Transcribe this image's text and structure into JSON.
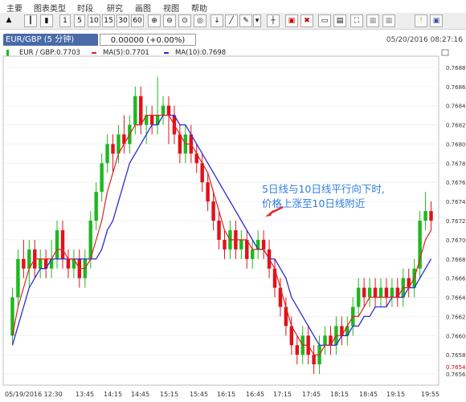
{
  "menu": [
    "主要",
    "图表类型",
    "时段",
    "研究",
    "画图",
    "视图",
    "帮助"
  ],
  "toolbar": {
    "periods": [
      "1",
      "5",
      "10",
      "15",
      "30",
      "60"
    ],
    "icons": [
      "pointer-icon",
      "bar-chart-icon",
      "candlestick-icon",
      "zoom-in-icon",
      "zoom-out-icon",
      "zoom-reset-icon",
      "zoom-fit-icon",
      "download-icon",
      "line-draw-icon",
      "pen-icon",
      "dropdown-icon",
      "crosshair-icon",
      "delete-box-icon",
      "delete-icon",
      "panel-icon",
      "panel2-icon",
      "fullscreen-icon",
      "print-icon",
      "save-icon",
      "flag-icon",
      "disk-icon"
    ]
  },
  "tab": {
    "symbol": "EUR/GBP (5 分钟)",
    "price": "0.00000 (+0.00%)",
    "datetime": "05/20/2016 08:27:16"
  },
  "legend": {
    "main": "EUR / GBP:0.7703",
    "ma5": "MA(5):0.7701",
    "ma10": "MA(10):0.7698"
  },
  "annotation": [
    "5日线与10日线平行向下时,",
    "价格上涨至10日线附近"
  ],
  "colors": {
    "up": "#1fb81f",
    "down": "#e0121a",
    "ma5": "#e02020",
    "ma10": "#2b2bd6",
    "annotation": "#2f7de0",
    "arrow": "#e03030"
  },
  "chart_data": {
    "type": "candlestick",
    "ylim": [
      0.7655,
      0.7689
    ],
    "yticks": [
      "0.7656",
      "0.7658",
      "0.7660",
      "0.7662",
      "0.7664",
      "0.7666",
      "0.7668",
      "0.7670",
      "0.7672",
      "0.7674",
      "0.7676",
      "0.7678",
      "0.7680",
      "0.7682",
      "0.7684",
      "0.7686",
      "0.7688"
    ],
    "xticks": [
      "05/19/2016 12:30",
      "13:45",
      "14:15",
      "14:45",
      "15:15",
      "15:45",
      "16:15",
      "16:45",
      "17:15",
      "17:45",
      "18:15",
      "18:45",
      "19:15",
      "19:55"
    ],
    "last_price_label": "0.7654",
    "candles": [
      [
        0.766,
        0.7664,
        0.7659,
        0.7665
      ],
      [
        0.7664,
        0.7668,
        0.7663,
        0.7669
      ],
      [
        0.7668,
        0.7667,
        0.7666,
        0.767
      ],
      [
        0.7667,
        0.7669,
        0.7665,
        0.767
      ],
      [
        0.7669,
        0.7667,
        0.7666,
        0.767
      ],
      [
        0.7667,
        0.7668,
        0.7666,
        0.7669
      ],
      [
        0.7668,
        0.7667,
        0.7666,
        0.7669
      ],
      [
        0.7667,
        0.7668,
        0.7666,
        0.767
      ],
      [
        0.7668,
        0.7671,
        0.7667,
        0.7672
      ],
      [
        0.7671,
        0.7668,
        0.7667,
        0.7672
      ],
      [
        0.7668,
        0.7667,
        0.7666,
        0.7669
      ],
      [
        0.7667,
        0.7668,
        0.7666,
        0.7669
      ],
      [
        0.7668,
        0.7666,
        0.7665,
        0.7669
      ],
      [
        0.7666,
        0.7668,
        0.7665,
        0.7669
      ],
      [
        0.7668,
        0.7672,
        0.7667,
        0.7673
      ],
      [
        0.7672,
        0.7675,
        0.7671,
        0.7676
      ],
      [
        0.7675,
        0.7678,
        0.7674,
        0.7679
      ],
      [
        0.7678,
        0.768,
        0.7677,
        0.7681
      ],
      [
        0.768,
        0.7679,
        0.7677,
        0.7681
      ],
      [
        0.7679,
        0.7681,
        0.7678,
        0.7682
      ],
      [
        0.7681,
        0.768,
        0.7679,
        0.7683
      ],
      [
        0.768,
        0.7682,
        0.7679,
        0.7683
      ],
      [
        0.7682,
        0.7685,
        0.7681,
        0.7686
      ],
      [
        0.7685,
        0.7682,
        0.7681,
        0.7686
      ],
      [
        0.7682,
        0.7683,
        0.768,
        0.7684
      ],
      [
        0.7683,
        0.7682,
        0.7681,
        0.7684
      ],
      [
        0.7682,
        0.7683,
        0.7681,
        0.7687
      ],
      [
        0.7683,
        0.7684,
        0.7682,
        0.7685
      ],
      [
        0.7684,
        0.7683,
        0.768,
        0.7685
      ],
      [
        0.7683,
        0.7681,
        0.768,
        0.7684
      ],
      [
        0.7681,
        0.7679,
        0.7678,
        0.7682
      ],
      [
        0.7679,
        0.7681,
        0.7678,
        0.7682
      ],
      [
        0.7681,
        0.7679,
        0.7678,
        0.7682
      ],
      [
        0.7679,
        0.7678,
        0.7677,
        0.768
      ],
      [
        0.7678,
        0.7676,
        0.7675,
        0.7679
      ],
      [
        0.7676,
        0.7674,
        0.7673,
        0.7677
      ],
      [
        0.7674,
        0.7672,
        0.7671,
        0.7675
      ],
      [
        0.7672,
        0.767,
        0.7669,
        0.7673
      ],
      [
        0.767,
        0.7669,
        0.7668,
        0.7671
      ],
      [
        0.7669,
        0.7671,
        0.7668,
        0.7672
      ],
      [
        0.7671,
        0.7669,
        0.7668,
        0.7672
      ],
      [
        0.7669,
        0.767,
        0.7668,
        0.7671
      ],
      [
        0.767,
        0.7668,
        0.7667,
        0.7671
      ],
      [
        0.7668,
        0.7669,
        0.7667,
        0.767
      ],
      [
        0.7669,
        0.767,
        0.7668,
        0.7671
      ],
      [
        0.767,
        0.7669,
        0.7668,
        0.7671
      ],
      [
        0.7669,
        0.7667,
        0.7666,
        0.767
      ],
      [
        0.7667,
        0.7665,
        0.7664,
        0.7668
      ],
      [
        0.7665,
        0.7663,
        0.7662,
        0.7666
      ],
      [
        0.7663,
        0.7661,
        0.766,
        0.7664
      ],
      [
        0.7661,
        0.7659,
        0.7658,
        0.7662
      ],
      [
        0.7659,
        0.7658,
        0.7657,
        0.766
      ],
      [
        0.7658,
        0.766,
        0.7657,
        0.7661
      ],
      [
        0.766,
        0.7658,
        0.7657,
        0.7661
      ],
      [
        0.7658,
        0.7657,
        0.7656,
        0.7659
      ],
      [
        0.7657,
        0.7659,
        0.7656,
        0.766
      ],
      [
        0.7659,
        0.766,
        0.7658,
        0.7661
      ],
      [
        0.766,
        0.7659,
        0.7658,
        0.7661
      ],
      [
        0.7659,
        0.7661,
        0.7658,
        0.7662
      ],
      [
        0.7661,
        0.766,
        0.7659,
        0.7662
      ],
      [
        0.766,
        0.7661,
        0.7659,
        0.7662
      ],
      [
        0.7661,
        0.7663,
        0.766,
        0.7664
      ],
      [
        0.7663,
        0.7665,
        0.7662,
        0.7666
      ],
      [
        0.7665,
        0.7664,
        0.7663,
        0.7666
      ],
      [
        0.7664,
        0.7665,
        0.7663,
        0.7666
      ],
      [
        0.7665,
        0.7664,
        0.7663,
        0.7666
      ],
      [
        0.7664,
        0.7665,
        0.7663,
        0.7666
      ],
      [
        0.7665,
        0.7664,
        0.7663,
        0.7666
      ],
      [
        0.7664,
        0.7665,
        0.7663,
        0.7666
      ],
      [
        0.7665,
        0.7664,
        0.7663,
        0.7666
      ],
      [
        0.7664,
        0.7666,
        0.7663,
        0.7667
      ],
      [
        0.7666,
        0.7665,
        0.7664,
        0.7667
      ],
      [
        0.7665,
        0.7667,
        0.7664,
        0.7668
      ],
      [
        0.7667,
        0.7672,
        0.7666,
        0.7673
      ],
      [
        0.7672,
        0.7673,
        0.7671,
        0.7675
      ],
      [
        0.7673,
        0.7672,
        0.7671,
        0.7674
      ]
    ],
    "ma5": [
      0.766,
      0.7663,
      0.7665,
      0.7667,
      0.7668,
      0.7668,
      0.7668,
      0.7668,
      0.7669,
      0.7669,
      0.7668,
      0.7668,
      0.7667,
      0.7667,
      0.7668,
      0.767,
      0.7672,
      0.7675,
      0.7677,
      0.7679,
      0.768,
      0.7681,
      0.7682,
      0.7682,
      0.7683,
      0.7683,
      0.7683,
      0.7683,
      0.7683,
      0.7682,
      0.7681,
      0.768,
      0.768,
      0.7679,
      0.7678,
      0.7677,
      0.7675,
      0.7673,
      0.7671,
      0.767,
      0.767,
      0.767,
      0.767,
      0.7669,
      0.7669,
      0.7669,
      0.7668,
      0.7667,
      0.7665,
      0.7663,
      0.7661,
      0.766,
      0.7659,
      0.7659,
      0.7658,
      0.7658,
      0.7659,
      0.7659,
      0.766,
      0.766,
      0.7661,
      0.7662,
      0.7662,
      0.7663,
      0.7664,
      0.7664,
      0.7664,
      0.7664,
      0.7664,
      0.7664,
      0.7665,
      0.7665,
      0.7666,
      0.7668,
      0.767,
      0.7671
    ],
    "ma10": [
      0.7659,
      0.7661,
      0.7663,
      0.7665,
      0.7666,
      0.7667,
      0.7667,
      0.7668,
      0.7668,
      0.7668,
      0.7668,
      0.7668,
      0.7668,
      0.7668,
      0.7668,
      0.7668,
      0.7669,
      0.7671,
      0.7672,
      0.7674,
      0.7676,
      0.7678,
      0.7679,
      0.768,
      0.7681,
      0.7682,
      0.7682,
      0.7683,
      0.7683,
      0.7683,
      0.7682,
      0.7682,
      0.7681,
      0.768,
      0.7679,
      0.7678,
      0.7677,
      0.7676,
      0.7675,
      0.7674,
      0.7673,
      0.7672,
      0.7671,
      0.767,
      0.7669,
      0.7669,
      0.7668,
      0.7668,
      0.7667,
      0.7666,
      0.7664,
      0.7663,
      0.7662,
      0.7661,
      0.766,
      0.7659,
      0.7659,
      0.7659,
      0.7659,
      0.766,
      0.766,
      0.7661,
      0.7661,
      0.7662,
      0.7662,
      0.7663,
      0.7663,
      0.7663,
      0.7664,
      0.7664,
      0.7664,
      0.7665,
      0.7665,
      0.7666,
      0.7667,
      0.7668
    ]
  }
}
